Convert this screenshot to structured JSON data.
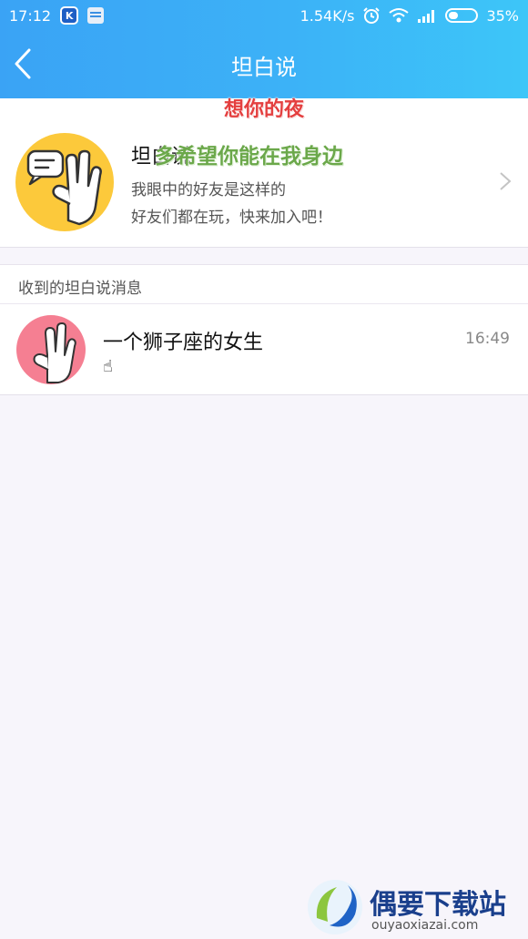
{
  "status_bar": {
    "time": "17:12",
    "speed": "1.54K/s",
    "battery": "35%",
    "icons": [
      "k-app-icon",
      "gallery-app-icon",
      "alarm-icon",
      "wifi-icon",
      "signal-icon",
      "battery-icon"
    ]
  },
  "header": {
    "title": "坦白说",
    "back_icon": "back-arrow-icon"
  },
  "intro_card": {
    "title": "坦白说",
    "subtitle_1": "我眼中的好友是这样的",
    "subtitle_2": "好友们都在玩，快来加入吧！",
    "icon": "speech-bubble-hand-icon"
  },
  "overlay": {
    "line_1": "想你的夜",
    "line_2": "多希望你能在我身边"
  },
  "section": {
    "label": "收到的坦白说消息"
  },
  "messages": [
    {
      "name": "一个狮子座的女生",
      "time": "16:49",
      "preview": "☝"
    }
  ],
  "watermark": {
    "text": "偶要下载站",
    "url": "ouyaoxiazai.com"
  },
  "colors": {
    "header_gradient_start": "#3aa3f5",
    "header_gradient_end": "#3dc6f8",
    "intro_icon_bg": "#fcc93b",
    "avatar_bg": "#f57f92",
    "overlay_red": "#e43f3f",
    "overlay_green": "#6ba84a"
  }
}
